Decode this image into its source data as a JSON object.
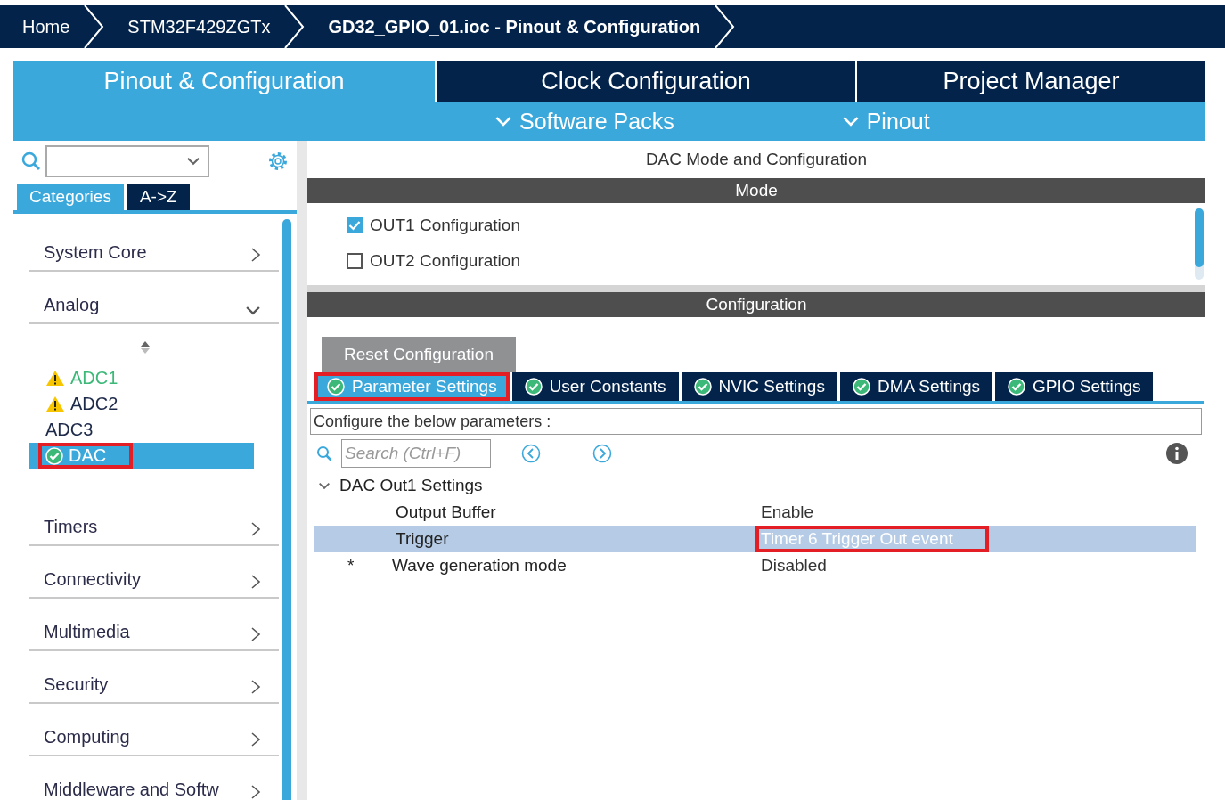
{
  "breadcrumb": [
    {
      "label": "Home",
      "current": false
    },
    {
      "label": "STM32F429ZGTx",
      "current": false
    },
    {
      "label": "GD32_GPIO_01.ioc - Pinout & Configuration",
      "current": true
    }
  ],
  "main_tabs": [
    {
      "label": "Pinout & Configuration",
      "selected": true
    },
    {
      "label": "Clock Configuration",
      "selected": false
    },
    {
      "label": "Project Manager",
      "selected": false
    }
  ],
  "sub_menus": [
    "Software Packs",
    "Pinout"
  ],
  "sidebar": {
    "tabs": [
      {
        "label": "Categories",
        "selected": true
      },
      {
        "label": "A->Z",
        "selected": false
      }
    ],
    "categories": [
      {
        "label": "System Core",
        "expanded": false
      },
      {
        "label": "Analog",
        "expanded": true,
        "children": [
          {
            "label": "ADC1",
            "kind": "warning",
            "enabled": true,
            "selected": false,
            "highlighted": false
          },
          {
            "label": "ADC2",
            "kind": "warning",
            "enabled": false,
            "selected": false,
            "highlighted": false
          },
          {
            "label": "ADC3",
            "kind": "plain",
            "enabled": false,
            "selected": false,
            "highlighted": false
          },
          {
            "label": "DAC",
            "kind": "ok",
            "enabled": false,
            "selected": true,
            "highlighted": true
          }
        ]
      },
      {
        "label": "Timers",
        "expanded": false
      },
      {
        "label": "Connectivity",
        "expanded": false
      },
      {
        "label": "Multimedia",
        "expanded": false
      },
      {
        "label": "Security",
        "expanded": false
      },
      {
        "label": "Computing",
        "expanded": false
      },
      {
        "label": "Middleware and Softw",
        "expanded": false
      }
    ]
  },
  "panel": {
    "title": "DAC Mode and Configuration",
    "mode_header": "Mode",
    "mode_options": [
      {
        "label": "OUT1 Configuration",
        "checked": true
      },
      {
        "label": "OUT2 Configuration",
        "checked": false
      }
    ],
    "config_header": "Configuration",
    "reset_button": "Reset Configuration",
    "config_tabs": [
      {
        "label": "Parameter Settings",
        "selected": true,
        "highlighted": true
      },
      {
        "label": "User Constants",
        "selected": false,
        "highlighted": false
      },
      {
        "label": "NVIC Settings",
        "selected": false,
        "highlighted": false
      },
      {
        "label": "DMA Settings",
        "selected": false,
        "highlighted": false
      },
      {
        "label": "GPIO Settings",
        "selected": false,
        "highlighted": false
      }
    ],
    "hint": "Configure the below parameters :",
    "search": {
      "placeholder": "Search (Ctrl+F)"
    },
    "tree": [
      {
        "label": "DAC Out1 Settings",
        "expanded": true,
        "children": [
          {
            "name": "Output Buffer",
            "value": "Enable",
            "selected": false,
            "highlighted": false
          },
          {
            "name": "Trigger",
            "value": "Timer 6 Trigger Out event",
            "selected": true,
            "highlighted": true
          },
          {
            "marker": "*",
            "name": "Wave generation mode",
            "value": "Disabled",
            "selected": false,
            "highlighted": false
          }
        ]
      }
    ]
  }
}
